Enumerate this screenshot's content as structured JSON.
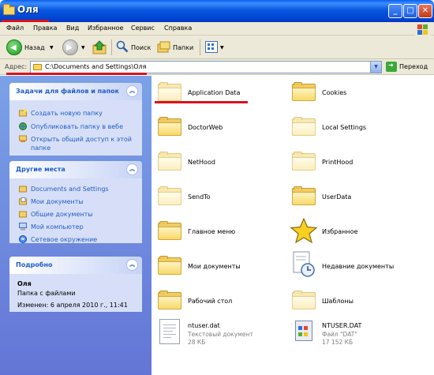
{
  "window": {
    "title": "Оля"
  },
  "menu": [
    "Файл",
    "Правка",
    "Вид",
    "Избранное",
    "Сервис",
    "Справка"
  ],
  "toolbar": {
    "back": "Назад",
    "search": "Поиск",
    "folders": "Папки"
  },
  "address": {
    "label": "Адрес:",
    "value": "C:\\Documents and Settings\\Оля",
    "go": "Переход"
  },
  "tasks": {
    "file_tasks": {
      "title": "Задачи для файлов и папок",
      "items": [
        "Создать новую папку",
        "Опубликовать папку в вебе",
        "Открыть общий доступ к этой",
        "папке"
      ]
    },
    "other_places": {
      "title": "Другие места",
      "items": [
        "Documents and Settings",
        "Мои документы",
        "Общие документы",
        "Мой компьютер",
        "Сетевое окружение"
      ]
    },
    "details": {
      "title": "Подробно",
      "name": "Оля",
      "type": "Папка с файлами",
      "modified": "Изменен: 6 апреля 2010 г., 11:41"
    }
  },
  "items": [
    {
      "name": "Application Data",
      "icon": "folder-faded-icon"
    },
    {
      "name": "Cookies",
      "icon": "folder-icon"
    },
    {
      "name": "DoctorWeb",
      "icon": "folder-icon"
    },
    {
      "name": "Local Settings",
      "icon": "folder-faded-icon"
    },
    {
      "name": "NetHood",
      "icon": "folder-faded-icon"
    },
    {
      "name": "PrintHood",
      "icon": "folder-faded-icon"
    },
    {
      "name": "SendTo",
      "icon": "folder-faded-icon"
    },
    {
      "name": "UserData",
      "icon": "folder-icon"
    },
    {
      "name": "Главное меню",
      "icon": "folder-icon"
    },
    {
      "name": "Избранное",
      "icon": "star-icon"
    },
    {
      "name": "Мои документы",
      "icon": "folder-icon"
    },
    {
      "name": "Недавние документы",
      "icon": "recent-docs-icon"
    },
    {
      "name": "Рабочий стол",
      "icon": "folder-icon"
    },
    {
      "name": "Шаблоны",
      "icon": "folder-faded-icon"
    },
    {
      "name": "ntuser.dat",
      "sub1": "Текстовый документ",
      "sub2": "28 КБ",
      "icon": "text-doc-icon"
    },
    {
      "name": "NTUSER.DAT",
      "sub1": "Файл \"DAT\"",
      "sub2": "17 152 КБ",
      "icon": "dat-file-icon"
    }
  ],
  "colors": {
    "annotation": "#d8121e",
    "title_bar": "#0a58e0",
    "task_link": "#215dc6"
  }
}
